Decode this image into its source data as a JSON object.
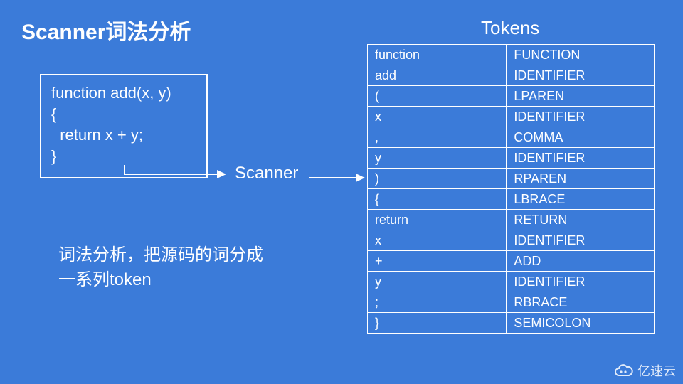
{
  "title": "Scanner词法分析",
  "tokens_heading": "Tokens",
  "code_lines": [
    "function add(x, y)",
    "{",
    "  return x + y;",
    "}"
  ],
  "scanner_label": "Scanner",
  "description_line1": "词法分析，把源码的词分成",
  "description_line2": "一系列token",
  "tokens": [
    {
      "lexeme": "function",
      "type": "FUNCTION"
    },
    {
      "lexeme": "add",
      "type": "IDENTIFIER"
    },
    {
      "lexeme": "(",
      "type": "LPAREN"
    },
    {
      "lexeme": "x",
      "type": "IDENTIFIER"
    },
    {
      "lexeme": ",",
      "type": "COMMA"
    },
    {
      "lexeme": "y",
      "type": "IDENTIFIER"
    },
    {
      "lexeme": ")",
      "type": "RPAREN"
    },
    {
      "lexeme": "{",
      "type": "LBRACE"
    },
    {
      "lexeme": "return",
      "type": "RETURN"
    },
    {
      "lexeme": "x",
      "type": "IDENTIFIER"
    },
    {
      "lexeme": "+",
      "type": "ADD"
    },
    {
      "lexeme": "y",
      "type": "IDENTIFIER"
    },
    {
      "lexeme": ";",
      "type": "RBRACE"
    },
    {
      "lexeme": "}",
      "type": "SEMICOLON"
    }
  ],
  "watermark": "亿速云",
  "colors": {
    "background": "#3b7bd9",
    "foreground": "#ffffff"
  }
}
